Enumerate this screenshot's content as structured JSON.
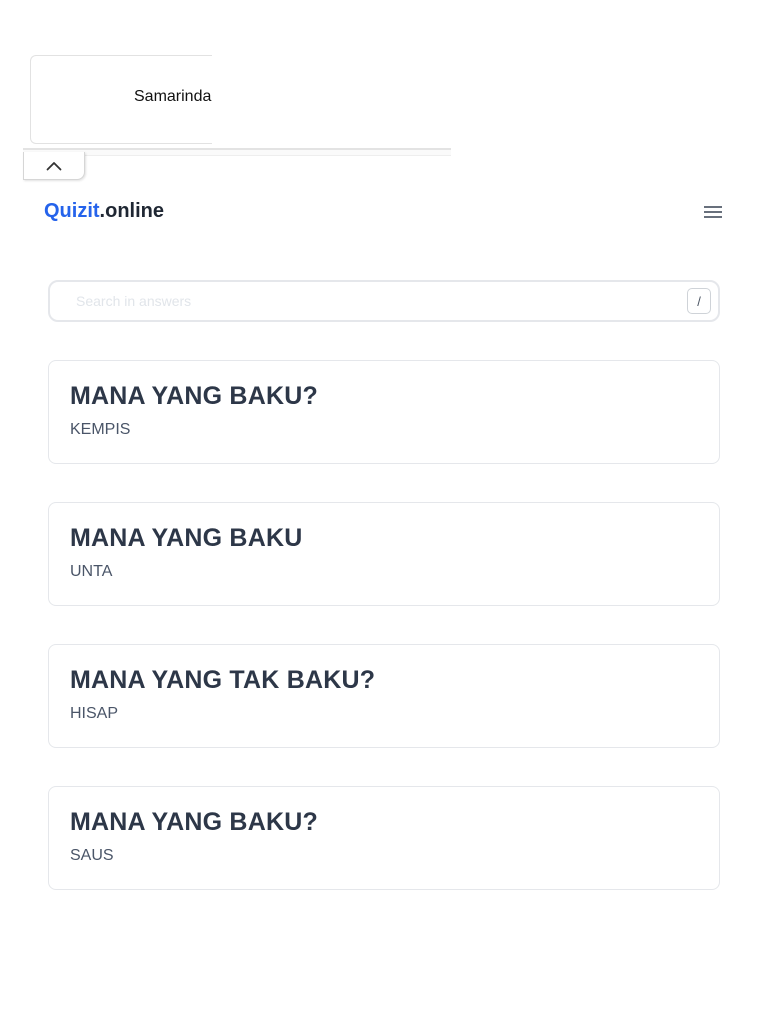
{
  "ad": {
    "text": "Samarinda",
    "collapse_icon": "chevron-up-icon"
  },
  "header": {
    "logo_brand": "Quizit",
    "logo_suffix": ".online",
    "menu_icon": "hamburger-menu-icon"
  },
  "search": {
    "placeholder": "Search in answers",
    "value": "",
    "shortcut": "/"
  },
  "cards": [
    {
      "title": "MANA YANG BAKU?",
      "answer": "KEMPIS"
    },
    {
      "title": "MANA YANG BAKU",
      "answer": "UNTA"
    },
    {
      "title": "MANA YANG TAK BAKU?",
      "answer": "HISAP"
    },
    {
      "title": "MANA YANG BAKU?",
      "answer": "SAUS"
    }
  ],
  "colors": {
    "brand": "#2563eb",
    "text_dark": "#2d3748",
    "text_muted": "#4a5568",
    "border": "#e5e7eb"
  }
}
